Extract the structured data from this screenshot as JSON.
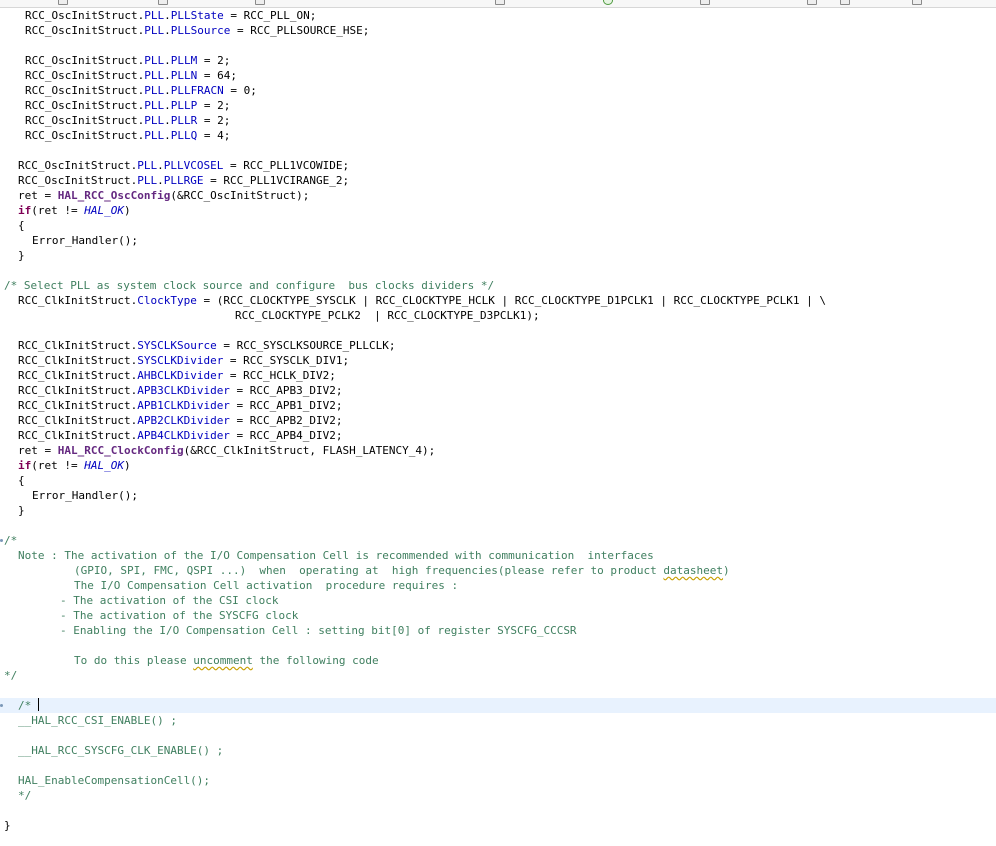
{
  "toolbar": {
    "icons": [
      "file-icon",
      "open-icon",
      "save-icon",
      "search-icon",
      "run-icon",
      "page-icon",
      "window-icon",
      "nav-icon",
      "layout-icon"
    ]
  },
  "editor": {
    "current_line_index": 46,
    "lines": [
      {
        "indent": 0,
        "tokens": [
          [
            "",
            "RCC_OscInitStruct."
          ],
          [
            "f",
            "PLL"
          ],
          [
            "",
            "."
          ],
          [
            "f",
            "PLLState"
          ],
          [
            "",
            " = RCC_PLL_ON;"
          ]
        ]
      },
      {
        "indent": 0,
        "tokens": [
          [
            "",
            "RCC_OscInitStruct."
          ],
          [
            "f",
            "PLL"
          ],
          [
            "",
            "."
          ],
          [
            "f",
            "PLLSource"
          ],
          [
            "",
            " = RCC_PLLSOURCE_HSE;"
          ]
        ]
      },
      {
        "indent": 0,
        "tokens": []
      },
      {
        "indent": 0,
        "tokens": [
          [
            "",
            "RCC_OscInitStruct."
          ],
          [
            "f",
            "PLL"
          ],
          [
            "",
            "."
          ],
          [
            "f",
            "PLLM"
          ],
          [
            "",
            " = 2;"
          ]
        ]
      },
      {
        "indent": 0,
        "tokens": [
          [
            "",
            "RCC_OscInitStruct."
          ],
          [
            "f",
            "PLL"
          ],
          [
            "",
            "."
          ],
          [
            "f",
            "PLLN"
          ],
          [
            "",
            " = 64;"
          ]
        ]
      },
      {
        "indent": 0,
        "tokens": [
          [
            "",
            "RCC_OscInitStruct."
          ],
          [
            "f",
            "PLL"
          ],
          [
            "",
            "."
          ],
          [
            "f",
            "PLLFRACN"
          ],
          [
            "",
            " = 0;"
          ]
        ]
      },
      {
        "indent": 0,
        "tokens": [
          [
            "",
            "RCC_OscInitStruct."
          ],
          [
            "f",
            "PLL"
          ],
          [
            "",
            "."
          ],
          [
            "f",
            "PLLP"
          ],
          [
            "",
            " = 2;"
          ]
        ]
      },
      {
        "indent": 0,
        "tokens": [
          [
            "",
            "RCC_OscInitStruct."
          ],
          [
            "f",
            "PLL"
          ],
          [
            "",
            "."
          ],
          [
            "f",
            "PLLR"
          ],
          [
            "",
            " = 2;"
          ]
        ]
      },
      {
        "indent": 0,
        "tokens": [
          [
            "",
            "RCC_OscInitStruct."
          ],
          [
            "f",
            "PLL"
          ],
          [
            "",
            "."
          ],
          [
            "f",
            "PLLQ"
          ],
          [
            "",
            " = 4;"
          ]
        ]
      },
      {
        "indent": 0,
        "tokens": []
      },
      {
        "indent": 1,
        "tokens": [
          [
            "",
            "RCC_OscInitStruct."
          ],
          [
            "f",
            "PLL"
          ],
          [
            "",
            "."
          ],
          [
            "f",
            "PLLVCOSEL"
          ],
          [
            "",
            " = RCC_PLL1VCOWIDE;"
          ]
        ]
      },
      {
        "indent": 1,
        "tokens": [
          [
            "",
            "RCC_OscInitStruct."
          ],
          [
            "f",
            "PLL"
          ],
          [
            "",
            "."
          ],
          [
            "f",
            "PLLRGE"
          ],
          [
            "",
            " = RCC_PLL1VCIRANGE_2;"
          ]
        ]
      },
      {
        "indent": 1,
        "tokens": [
          [
            "",
            "ret = "
          ],
          [
            "fnb",
            "HAL_RCC_OscConfig"
          ],
          [
            "",
            "(&RCC_OscInitStruct);"
          ]
        ]
      },
      {
        "indent": 1,
        "tokens": [
          [
            "k",
            "if"
          ],
          [
            "",
            "(ret != "
          ],
          [
            "it",
            "HAL_OK"
          ],
          [
            "",
            ")"
          ]
        ]
      },
      {
        "indent": 1,
        "tokens": [
          [
            "",
            "{"
          ]
        ]
      },
      {
        "indent": 2,
        "tokens": [
          [
            "",
            "Error_Handler();"
          ]
        ]
      },
      {
        "indent": 1,
        "tokens": [
          [
            "",
            "}"
          ]
        ]
      },
      {
        "indent": 0,
        "tokens": []
      },
      {
        "indent": 3,
        "tokens": [
          [
            "c",
            "/* Select PLL as system clock source and configure  bus clocks dividers */"
          ]
        ]
      },
      {
        "indent": 1,
        "tokens": [
          [
            "",
            "RCC_ClkInitStruct."
          ],
          [
            "f",
            "ClockType"
          ],
          [
            "",
            " = (RCC_CLOCKTYPE_SYSCLK | RCC_CLOCKTYPE_HCLK | RCC_CLOCKTYPE_D1PCLK1 | RCC_CLOCKTYPE_PCLK1 | \\"
          ]
        ]
      },
      {
        "indent": 4,
        "tokens": [
          [
            "",
            "RCC_CLOCKTYPE_PCLK2  | RCC_CLOCKTYPE_D3PCLK1);"
          ]
        ]
      },
      {
        "indent": 0,
        "tokens": []
      },
      {
        "indent": 1,
        "tokens": [
          [
            "",
            "RCC_ClkInitStruct."
          ],
          [
            "f",
            "SYSCLKSource"
          ],
          [
            "",
            " = RCC_SYSCLKSOURCE_PLLCLK;"
          ]
        ]
      },
      {
        "indent": 1,
        "tokens": [
          [
            "",
            "RCC_ClkInitStruct."
          ],
          [
            "f",
            "SYSCLKDivider"
          ],
          [
            "",
            " = RCC_SYSCLK_DIV1;"
          ]
        ]
      },
      {
        "indent": 1,
        "tokens": [
          [
            "",
            "RCC_ClkInitStruct."
          ],
          [
            "f",
            "AHBCLKDivider"
          ],
          [
            "",
            " = RCC_HCLK_DIV2;"
          ]
        ]
      },
      {
        "indent": 1,
        "tokens": [
          [
            "",
            "RCC_ClkInitStruct."
          ],
          [
            "f",
            "APB3CLKDivider"
          ],
          [
            "",
            " = RCC_APB3_DIV2;"
          ]
        ]
      },
      {
        "indent": 1,
        "tokens": [
          [
            "",
            "RCC_ClkInitStruct."
          ],
          [
            "f",
            "APB1CLKDivider"
          ],
          [
            "",
            " = RCC_APB1_DIV2;"
          ]
        ]
      },
      {
        "indent": 1,
        "tokens": [
          [
            "",
            "RCC_ClkInitStruct."
          ],
          [
            "f",
            "APB2CLKDivider"
          ],
          [
            "",
            " = RCC_APB2_DIV2;"
          ]
        ]
      },
      {
        "indent": 1,
        "tokens": [
          [
            "",
            "RCC_ClkInitStruct."
          ],
          [
            "f",
            "APB4CLKDivider"
          ],
          [
            "",
            " = RCC_APB4_DIV2;"
          ]
        ]
      },
      {
        "indent": 1,
        "tokens": [
          [
            "",
            "ret = "
          ],
          [
            "fnb",
            "HAL_RCC_ClockConfig"
          ],
          [
            "",
            "(&RCC_ClkInitStruct, FLASH_LATENCY_4);"
          ]
        ]
      },
      {
        "indent": 1,
        "tokens": [
          [
            "k",
            "if"
          ],
          [
            "",
            "(ret != "
          ],
          [
            "it",
            "HAL_OK"
          ],
          [
            "",
            ")"
          ]
        ]
      },
      {
        "indent": 1,
        "tokens": [
          [
            "",
            "{"
          ]
        ]
      },
      {
        "indent": 2,
        "tokens": [
          [
            "",
            "Error_Handler();"
          ]
        ]
      },
      {
        "indent": 1,
        "tokens": [
          [
            "",
            "}"
          ]
        ]
      },
      {
        "indent": 0,
        "tokens": []
      },
      {
        "indent": 3,
        "tokens": [
          [
            "c",
            "/*"
          ]
        ]
      },
      {
        "indent": 1,
        "tokens": [
          [
            "c",
            "Note : The activation of the I/O Compensation Cell is recommended with communication  interfaces"
          ]
        ]
      },
      {
        "indent": 5,
        "tokens": [
          [
            "c",
            "(GPIO, SPI, FMC, QSPI ...)  when  operating at  high frequencies(please refer to product "
          ],
          [
            "csq",
            "datasheet"
          ],
          [
            "c",
            ")"
          ]
        ]
      },
      {
        "indent": 5,
        "tokens": [
          [
            "c",
            "The I/O Compensation Cell activation  procedure requires :"
          ]
        ]
      },
      {
        "indent": 6,
        "tokens": [
          [
            "c",
            "- The activation of the CSI clock"
          ]
        ]
      },
      {
        "indent": 6,
        "tokens": [
          [
            "c",
            "- The activation of the SYSCFG clock"
          ]
        ]
      },
      {
        "indent": 6,
        "tokens": [
          [
            "c",
            "- Enabling the I/O Compensation Cell : setting bit[0] of register SYSCFG_CCCSR"
          ]
        ]
      },
      {
        "indent": 0,
        "tokens": []
      },
      {
        "indent": 5,
        "tokens": [
          [
            "c",
            "To do this please "
          ],
          [
            "csq",
            "uncomment"
          ],
          [
            "c",
            " the following code"
          ]
        ]
      },
      {
        "indent": 3,
        "tokens": [
          [
            "c",
            "*/"
          ]
        ]
      },
      {
        "indent": 0,
        "tokens": []
      },
      {
        "indent": 1,
        "tokens": [
          [
            "c",
            "/* "
          ]
        ],
        "caret": true
      },
      {
        "indent": 1,
        "tokens": [
          [
            "c",
            "__HAL_RCC_CSI_ENABLE() ;"
          ]
        ]
      },
      {
        "indent": 0,
        "tokens": []
      },
      {
        "indent": 1,
        "tokens": [
          [
            "c",
            "__HAL_RCC_SYSCFG_CLK_ENABLE() ;"
          ]
        ]
      },
      {
        "indent": 0,
        "tokens": []
      },
      {
        "indent": 1,
        "tokens": [
          [
            "c",
            "HAL_EnableCompensationCell();"
          ]
        ]
      },
      {
        "indent": 1,
        "tokens": [
          [
            "c",
            "*/"
          ]
        ]
      },
      {
        "indent": 0,
        "tokens": []
      },
      {
        "indent": 7,
        "tokens": [
          [
            "",
            "}"
          ]
        ]
      }
    ]
  }
}
